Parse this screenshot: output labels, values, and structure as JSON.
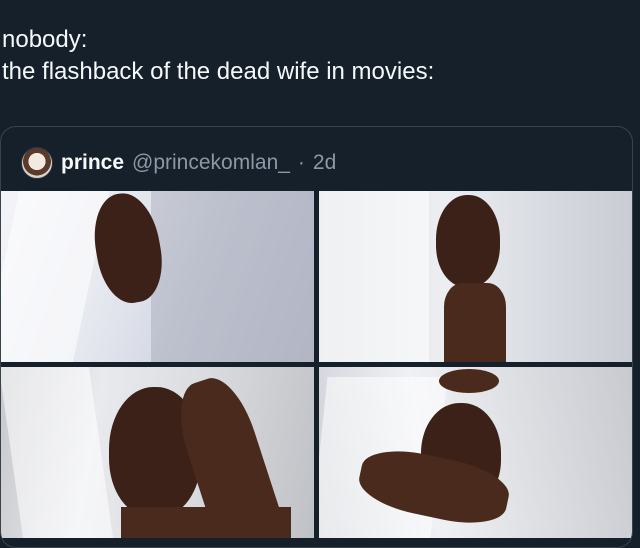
{
  "tweet": {
    "line1": "nobody:",
    "line2": "the flashback of the dead wife in movies:"
  },
  "quote": {
    "display_name": "prince",
    "handle": "@princekomlan_",
    "separator": "·",
    "age": "2d"
  }
}
